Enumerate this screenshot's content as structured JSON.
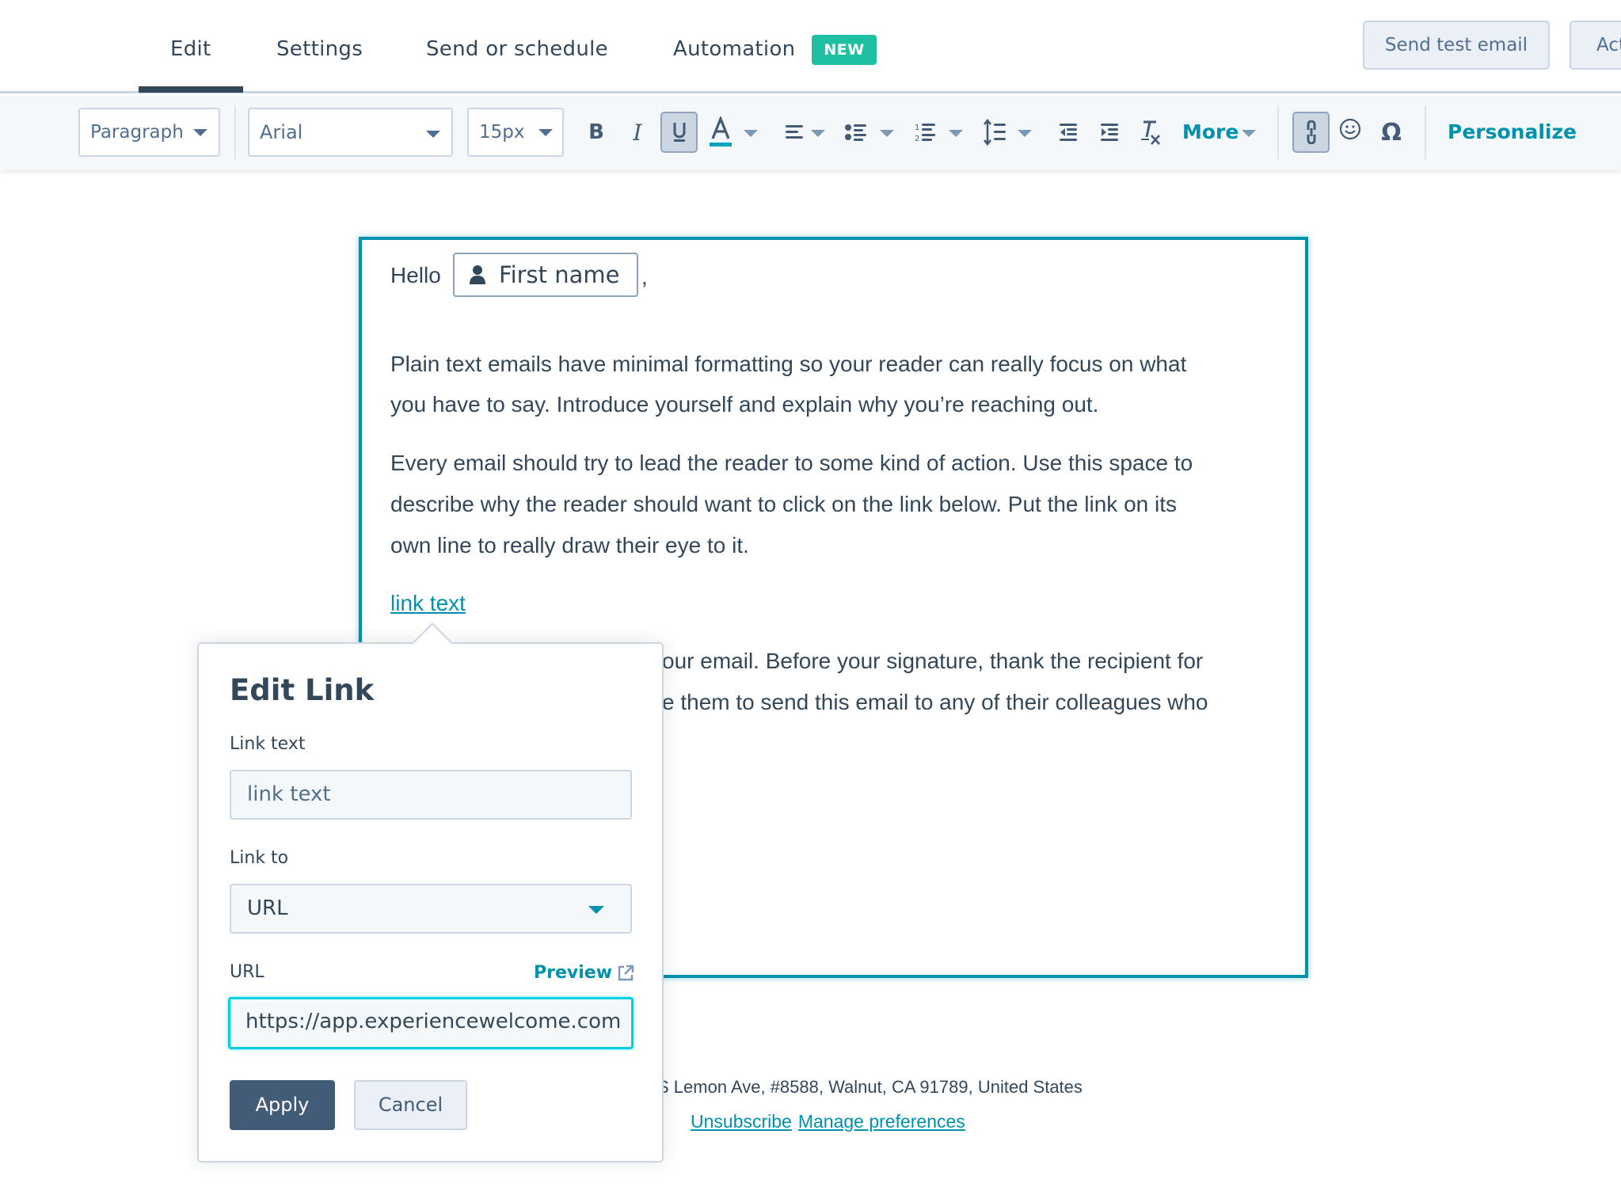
{
  "tabs": [
    {
      "label": "Edit",
      "active": true
    },
    {
      "label": "Settings",
      "active": false
    },
    {
      "label": "Send or schedule",
      "active": false
    },
    {
      "label": "Automation",
      "active": false,
      "badge": "NEW"
    }
  ],
  "header_buttons": {
    "send_test_email": "Send test email",
    "actions_truncated": "Act"
  },
  "toolbar": {
    "block_style": "Paragraph",
    "font_family": "Arial",
    "font_size": "15px",
    "bold_icon": "bold-icon",
    "italic_icon": "italic-icon",
    "underline_icon": "underline-icon",
    "underline_active": true,
    "text_color_icon": "text-color-icon",
    "text_color_swatch": "#00a4bd",
    "align_icon": "align-left-icon",
    "bulleted_list_icon": "bulleted-list-icon",
    "numbered_list_icon": "numbered-list-icon",
    "line_height_icon": "line-height-icon",
    "outdent_icon": "outdent-icon",
    "indent_icon": "indent-icon",
    "clear_format_icon": "clear-formatting-icon",
    "more_label": "More",
    "link_icon": "link-icon",
    "link_active": true,
    "emoji_icon": "emoji-icon",
    "special_char_icon": "omega-icon",
    "personalize_label": "Personalize"
  },
  "email": {
    "greeting": "Hello",
    "token_label": "First name",
    "greeting_suffix": ",",
    "para1_line1": "Plain text emails have minimal formatting so your reader can really focus on what",
    "para1_line2": "you have to say. Introduce yourself and explain why you’re reaching out.",
    "para2_line1": "Every email should try to lead the reader to some kind of action. Use this space to",
    "para2_line2": "describe why the reader should want to click on the link below. Put the link on its",
    "para2_line3": "own line to really draw their eye to it.",
    "link_text": "link text",
    "para3_line1_visible": "our email. Before your signature, thank the recipient for",
    "para3_line2_visible": "e them to send this email to any of their colleagues who"
  },
  "footer": {
    "address_visible": "S Lemon Ave, #8588, Walnut, CA 91789, United States",
    "unsubscribe": "Unsubscribe",
    "manage_preferences": "Manage preferences"
  },
  "edit_link_popup": {
    "title": "Edit Link",
    "link_text_label": "Link text",
    "link_text_value": "link text",
    "link_to_label": "Link to",
    "link_to_value": "URL",
    "url_label": "URL",
    "preview_label": "Preview",
    "url_value": "https://app.experiencewelcome.com",
    "apply_label": "Apply",
    "cancel_label": "Cancel"
  },
  "colors": {
    "accent": "#0091ae",
    "badge_new": "#1fbfa1",
    "primary_button": "#425b76",
    "text": "#33475b",
    "focus": "#00d0e4"
  }
}
